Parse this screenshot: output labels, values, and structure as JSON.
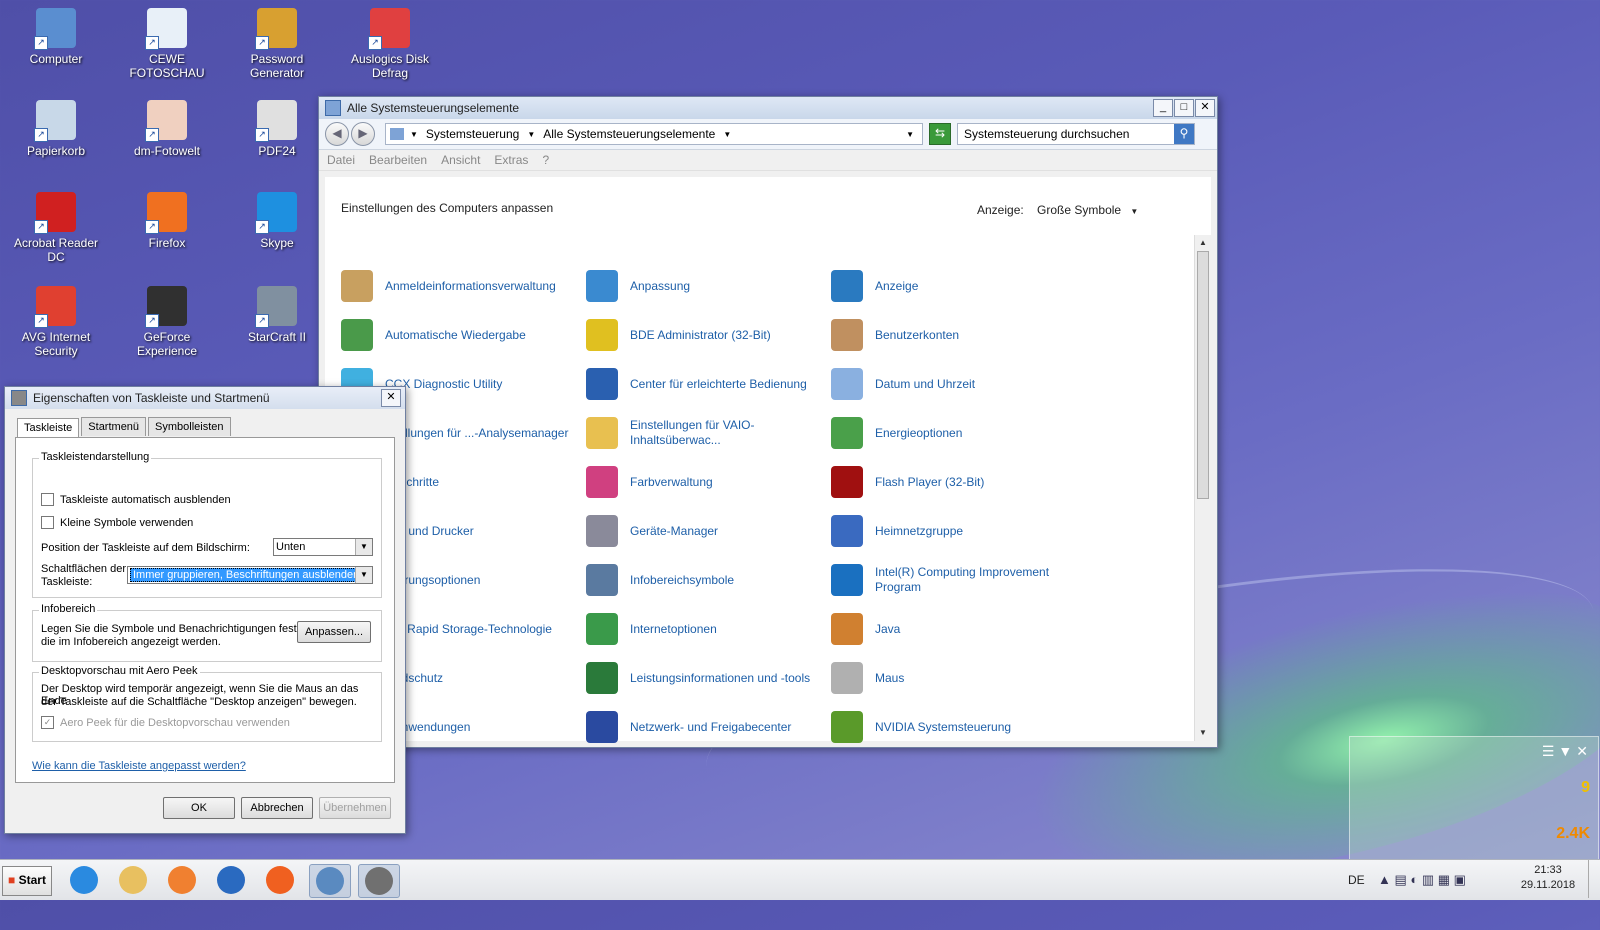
{
  "desktop_icons": [
    {
      "label": "Computer",
      "icon": "computer-icon",
      "color": "#5a8ed0"
    },
    {
      "label": "CEWE FOTOSCHAU",
      "icon": "cewe-icon",
      "color": "#e8f0f8"
    },
    {
      "label": "Password Generator",
      "icon": "key-icon",
      "color": "#d8a030"
    },
    {
      "label": "Auslogics Disk Defrag",
      "icon": "defrag-icon",
      "color": "#e04040"
    },
    {
      "label": "Papierkorb",
      "icon": "recycle-bin-icon",
      "color": "#c8d8e8"
    },
    {
      "label": "dm-Fotowelt",
      "icon": "dm-icon",
      "color": "#f0d0c0"
    },
    {
      "label": "PDF24",
      "icon": "pdf24-icon",
      "color": "#e0e0e0"
    },
    {
      "label": "Acrobat Reader DC",
      "icon": "acrobat-icon",
      "color": "#d02020"
    },
    {
      "label": "Firefox",
      "icon": "firefox-icon",
      "color": "#f07020"
    },
    {
      "label": "Skype",
      "icon": "skype-icon",
      "color": "#1e90e0"
    },
    {
      "label": "AVG Internet Security",
      "icon": "avg-icon",
      "color": "#e04030"
    },
    {
      "label": "GeForce Experience",
      "icon": "geforce-icon",
      "color": "#303030"
    },
    {
      "label": "StarCraft II",
      "icon": "starcraft-icon",
      "color": "#8090a0"
    }
  ],
  "control_panel": {
    "title": "Alle Systemsteuerungselemente",
    "breadcrumb": [
      "Systemsteuerung",
      "Alle Systemsteuerungselemente"
    ],
    "search_placeholder": "Systemsteuerung durchsuchen",
    "menu": [
      "Datei",
      "Bearbeiten",
      "Ansicht",
      "Extras",
      "?"
    ],
    "heading": "Einstellungen des Computers anpassen",
    "view_label": "Anzeige:",
    "view_value": "Große Symbole",
    "items": [
      [
        {
          "label": "Anmeldeinformationsverwaltung",
          "icon": "credential-manager-icon",
          "color": "#c8a060"
        },
        {
          "label": "Automatische Wiedergabe",
          "icon": "autoplay-icon",
          "color": "#4a9a4a"
        },
        {
          "label": "CCX Diagnostic Utility",
          "icon": "ccx-icon",
          "color": "#40b0e0"
        },
        {
          "label": "...tellungen für ...-Analysemanager",
          "icon": "analysis-icon",
          "color": "#6a8ad0"
        },
        {
          "label": "... Schritte",
          "icon": "steps-icon",
          "color": "#6a8ad0"
        },
        {
          "label": "...te und Drucker",
          "icon": "printer-icon",
          "color": "#6a8ad0"
        },
        {
          "label": "...ierungsoptionen",
          "icon": "index-icon",
          "color": "#6a8ad0"
        },
        {
          "label": "...® Rapid Storage-Technologie",
          "icon": "storage-icon",
          "color": "#6a8ad0"
        },
        {
          "label": "...ndschutz",
          "icon": "shield-icon",
          "color": "#6a8ad0"
        },
        {
          "label": "...anwendungen",
          "icon": "apps-icon",
          "color": "#6a8ad0"
        }
      ],
      [
        {
          "label": "Anpassung",
          "icon": "personalization-icon",
          "color": "#3a8ad0"
        },
        {
          "label": "BDE Administrator (32-Bit)",
          "icon": "bde-icon",
          "color": "#e0c020"
        },
        {
          "label": "Center für erleichterte Bedienung",
          "icon": "ease-of-access-icon",
          "color": "#2a60b0"
        },
        {
          "label": "Einstellungen für VAIO-Inhaltsüberwac...",
          "icon": "folder-icon",
          "color": "#e8c050"
        },
        {
          "label": "Farbverwaltung",
          "icon": "color-management-icon",
          "color": "#d04080"
        },
        {
          "label": "Geräte-Manager",
          "icon": "device-manager-icon",
          "color": "#8a8a9a"
        },
        {
          "label": "Infobereichsymbole",
          "icon": "tray-icons-icon",
          "color": "#5a7aa0"
        },
        {
          "label": "Internetoptionen",
          "icon": "internet-options-icon",
          "color": "#3a9a4a"
        },
        {
          "label": "Leistungsinformationen und -tools",
          "icon": "performance-icon",
          "color": "#2a7a3a"
        },
        {
          "label": "Netzwerk- und Freigabecenter",
          "icon": "network-icon",
          "color": "#2a4aa0"
        }
      ],
      [
        {
          "label": "Anzeige",
          "icon": "display-icon",
          "color": "#2a7ac0"
        },
        {
          "label": "Benutzerkonten",
          "icon": "users-icon",
          "color": "#c09060"
        },
        {
          "label": "Datum und Uhrzeit",
          "icon": "clock-icon",
          "color": "#8ab0e0"
        },
        {
          "label": "Energieoptionen",
          "icon": "power-icon",
          "color": "#4aa04a"
        },
        {
          "label": "Flash Player (32-Bit)",
          "icon": "flash-icon",
          "color": "#a01010"
        },
        {
          "label": "Heimnetzgruppe",
          "icon": "homegroup-icon",
          "color": "#3a6ac0"
        },
        {
          "label": "Intel(R) Computing Improvement Program",
          "icon": "intel-icon",
          "color": "#1a70c0"
        },
        {
          "label": "Java",
          "icon": "java-icon",
          "color": "#d08030"
        },
        {
          "label": "Maus",
          "icon": "mouse-icon",
          "color": "#b0b0b0"
        },
        {
          "label": "NVIDIA Systemsteuerung",
          "icon": "nvidia-icon",
          "color": "#5a9a2a"
        }
      ]
    ]
  },
  "dialog": {
    "title": "Eigenschaften von Taskleiste und Startmenü",
    "tabs": [
      "Taskleiste",
      "Startmenü",
      "Symbolleisten"
    ],
    "group1_title": "Taskleistendarstellung",
    "cb_autohide": "Taskleiste automatisch ausblenden",
    "cb_small": "Kleine Symbole verwenden",
    "position_label": "Position der Taskleiste auf dem Bildschirm:",
    "position_value": "Unten",
    "buttons_label_1": "Schaltflächen der",
    "buttons_label_2": "Taskleiste:",
    "buttons_value": "Immer gruppieren, Beschriftungen ausblenden",
    "group2_title": "Infobereich",
    "infobereich_text_1": "Legen Sie die Symbole und Benachrichtigungen fest,",
    "infobereich_text_2": "die im Infobereich angezeigt werden.",
    "customize_button": "Anpassen...",
    "group3_title": "Desktopvorschau mit Aero Peek",
    "aero_text_1": "Der Desktop wird temporär angezeigt, wenn Sie die Maus an das Ende",
    "aero_text_2": "der Taskleiste auf die Schaltfläche \"Desktop anzeigen\" bewegen.",
    "cb_aero": "Aero Peek für die Desktopvorschau verwenden",
    "help_link": "Wie kann die Taskleiste angepasst werden?",
    "ok": "OK",
    "cancel": "Abbrechen",
    "apply": "Übernehmen"
  },
  "taskbar": {
    "start_label": "Start",
    "apps": [
      {
        "name": "ie-icon",
        "color": "#2a8ae0"
      },
      {
        "name": "explorer-icon",
        "color": "#e8c060"
      },
      {
        "name": "media-player-icon",
        "color": "#f08030"
      },
      {
        "name": "thunderbird-icon",
        "color": "#2a6ac0"
      },
      {
        "name": "firefox-icon",
        "color": "#f06020"
      },
      {
        "name": "control-panel-icon",
        "color": "#5a8ac0"
      },
      {
        "name": "taskbar-properties-icon",
        "color": "#707070"
      }
    ],
    "lang": "DE",
    "time": "21:33",
    "date": "29.11.2018"
  },
  "gadget": {
    "value_top": "9",
    "value_bottom": "2.4K"
  }
}
